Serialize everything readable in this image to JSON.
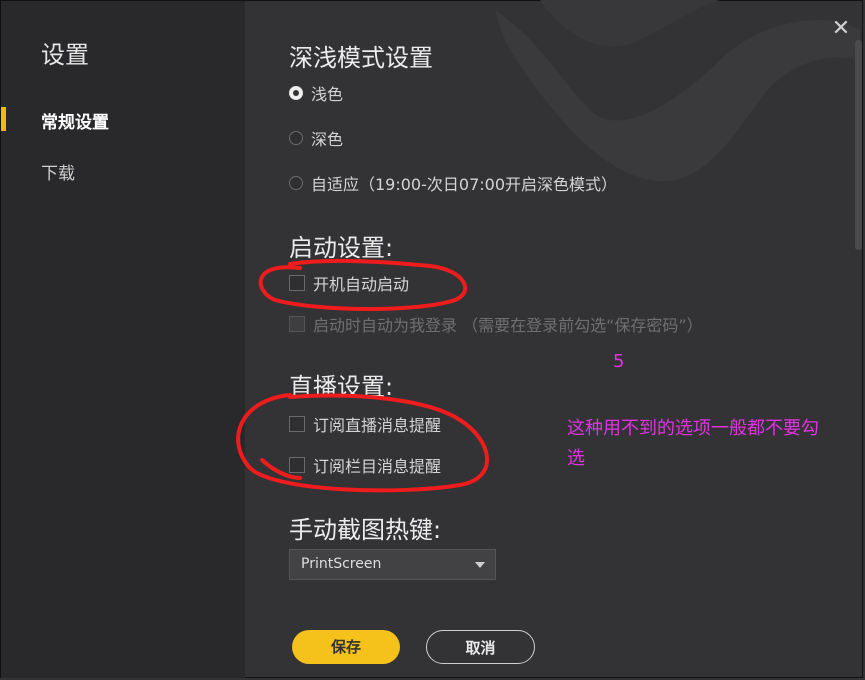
{
  "sidebar": {
    "title": "设置",
    "items": [
      {
        "label": "常规设置",
        "active": true
      },
      {
        "label": "下载",
        "active": false
      }
    ]
  },
  "theme": {
    "title": "深浅模式设置",
    "options": [
      {
        "label": "浅色",
        "selected": true
      },
      {
        "label": "深色",
        "selected": false
      },
      {
        "label": "自适应（19:00-次日07:00开启深色模式）",
        "selected": false
      }
    ]
  },
  "startup": {
    "title": "启动设置:",
    "options": [
      {
        "label": "开机自动启动",
        "checked": false,
        "disabled": false
      },
      {
        "label": "启动时自动为我登录 （需要在登录前勾选“保存密码”）",
        "checked": false,
        "disabled": true
      }
    ]
  },
  "live": {
    "title": "直播设置:",
    "options": [
      {
        "label": "订阅直播消息提醒",
        "checked": false
      },
      {
        "label": "订阅栏目消息提醒",
        "checked": false
      }
    ]
  },
  "hotkey": {
    "title": "手动截图热键:",
    "value": "PrintScreen"
  },
  "buttons": {
    "save": "保存",
    "cancel": "取消"
  },
  "annotations": {
    "number": "5",
    "note_line1": "这种用不到的选项一般都不要勾",
    "note_line2": "选",
    "color": "#e033e0",
    "circle_color": "#ee1c1c"
  },
  "colors": {
    "accent": "#f5c21b",
    "background": "#333336",
    "sidebar": "#29292b"
  }
}
